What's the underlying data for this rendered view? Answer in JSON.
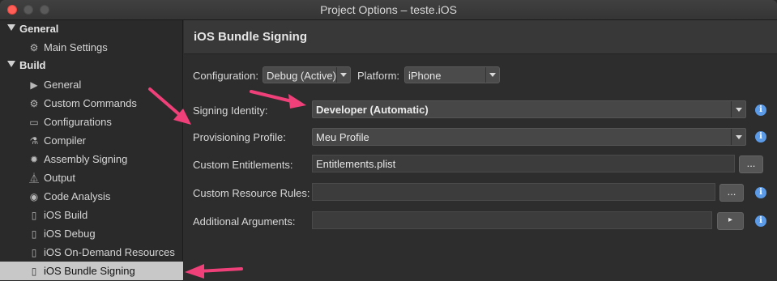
{
  "window": {
    "title": "Project Options – teste.iOS"
  },
  "sidebar": {
    "sections": [
      {
        "label": "General"
      },
      {
        "label": "Build"
      }
    ],
    "items": [
      {
        "label": "Main Settings",
        "icon": "gear-icon"
      },
      {
        "label": "General",
        "icon": "play-icon"
      },
      {
        "label": "Custom Commands",
        "icon": "gear-icon"
      },
      {
        "label": "Configurations",
        "icon": "window-icon"
      },
      {
        "label": "Compiler",
        "icon": "compiler-icon"
      },
      {
        "label": "Assembly Signing",
        "icon": "badge-icon"
      },
      {
        "label": "Output",
        "icon": "flask-icon"
      },
      {
        "label": "Code Analysis",
        "icon": "target-icon"
      },
      {
        "label": "iOS Build",
        "icon": "phone-icon"
      },
      {
        "label": "iOS Debug",
        "icon": "phone-icon"
      },
      {
        "label": "iOS On-Demand Resources",
        "icon": "phone-icon"
      },
      {
        "label": "iOS Bundle Signing",
        "icon": "phone-icon",
        "selected": true
      }
    ]
  },
  "content": {
    "header": "iOS Bundle Signing",
    "configuration": {
      "label": "Configuration:",
      "value": "Debug (Active)"
    },
    "platform": {
      "label": "Platform:",
      "value": "iPhone"
    },
    "signing_identity": {
      "label": "Signing Identity:",
      "value": "Developer (Automatic)"
    },
    "provisioning_profile": {
      "label": "Provisioning Profile:",
      "value": "Meu Profile"
    },
    "custom_entitlements": {
      "label": "Custom Entitlements:",
      "value": "Entitlements.plist",
      "button": "..."
    },
    "custom_resource_rules": {
      "label": "Custom Resource Rules:",
      "value": "",
      "button": "..."
    },
    "additional_arguments": {
      "label": "Additional Arguments:",
      "value": "",
      "button": "▸"
    }
  },
  "colors": {
    "info": "#5a9ae6",
    "arrows": "#f0407a",
    "selected_row": "#c8c8c8"
  }
}
